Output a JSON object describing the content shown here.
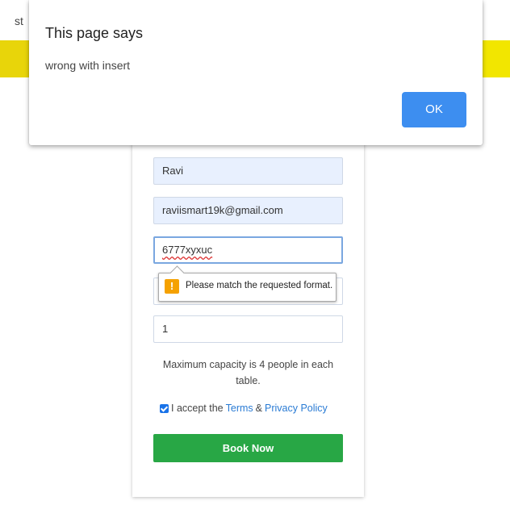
{
  "background": {
    "fragment_text": "st"
  },
  "dialog": {
    "title": "This page says",
    "message": "wrong with insert",
    "ok_label": "OK"
  },
  "form": {
    "name_value": "Ravi",
    "email_value": "raviismart19k@gmail.com",
    "phone_value": "6777xyxuc",
    "people_value": "1",
    "validation_message": "Please match the requested format.",
    "validation_icon": "!",
    "capacity_note": "Maximum capacity is 4 people in each table.",
    "accept_prefix": "I accept the",
    "terms_link": "Terms",
    "ampersand": "&",
    "privacy_link": "Privacy Policy",
    "accept_checked": true,
    "book_button": "Book Now"
  },
  "colors": {
    "accent_blue": "#3d8ef0",
    "book_green": "#28a745",
    "warning_orange": "#f5a100",
    "yellow_band": "#e8d50a"
  }
}
